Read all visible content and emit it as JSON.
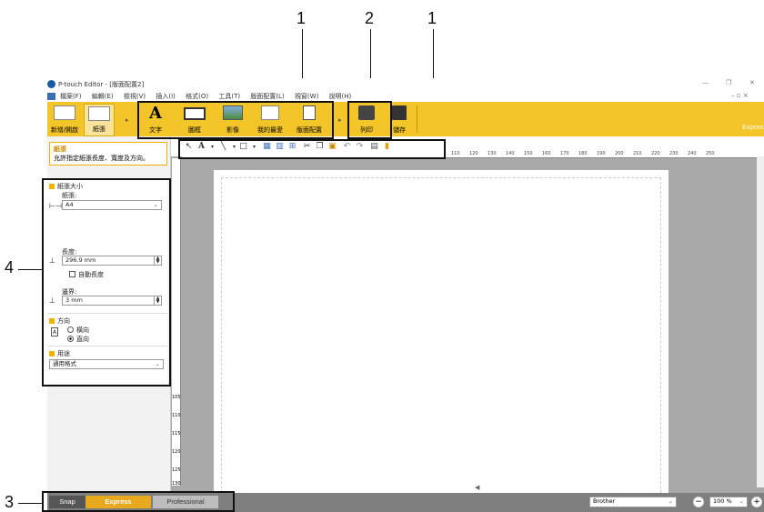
{
  "callouts": {
    "c1a": "1",
    "c2": "2",
    "c1b": "1",
    "c4": "4",
    "c3": "3"
  },
  "window": {
    "title": "P-touch Editor - [版面配置2]",
    "controls": {
      "min": "—",
      "max": "❐",
      "close": "✕"
    }
  },
  "menu": {
    "items": [
      "檔案(F)",
      "編輯(E)",
      "檢視(V)",
      "插入(I)",
      "格式(O)",
      "工具(T)",
      "版面配置(L)",
      "視窗(W)",
      "說明(H)"
    ],
    "right_icons": "– ▫ ×"
  },
  "ribbon": {
    "new_open": "新增/開啟",
    "paper": "紙張",
    "text": "文字",
    "frame": "圖框",
    "image": "影像",
    "favorite": "我的最愛",
    "layout": "版面配置",
    "print": "列印",
    "save": "儲存",
    "mode": "Expres"
  },
  "sidebar": {
    "header_title": "紙張",
    "header_desc": "允許指定紙張長度、寬度及方向。",
    "paper_size": {
      "section": "紙張大小",
      "paper_label": "紙張:",
      "paper_value": "A4",
      "length_label": "長度:",
      "length_value": "296.9 mm",
      "auto_length": "自動長度",
      "margin_label": "邊界:",
      "margin_value": "3 mm"
    },
    "orientation": {
      "section": "方向",
      "landscape": "橫向",
      "portrait": "直向"
    },
    "usage": {
      "section": "用途",
      "value": "通用格式"
    }
  },
  "ruler": {
    "ticks": [
      "110",
      "120",
      "130",
      "140",
      "150",
      "160",
      "170",
      "180",
      "190",
      "200",
      "210",
      "220",
      "230",
      "240",
      "250"
    ],
    "vticks": [
      "105",
      "110",
      "115",
      "120",
      "125",
      "130"
    ]
  },
  "status": {
    "snap": "Snap",
    "express": "Express",
    "professional": "Professional",
    "printer": "Brother",
    "zoom": "100 %",
    "page_indicator": "◀"
  },
  "colors": {
    "ribbon_yellow": "#f4c528",
    "express_active": "#e9a91e",
    "status_gray": "#7f7f7f"
  }
}
